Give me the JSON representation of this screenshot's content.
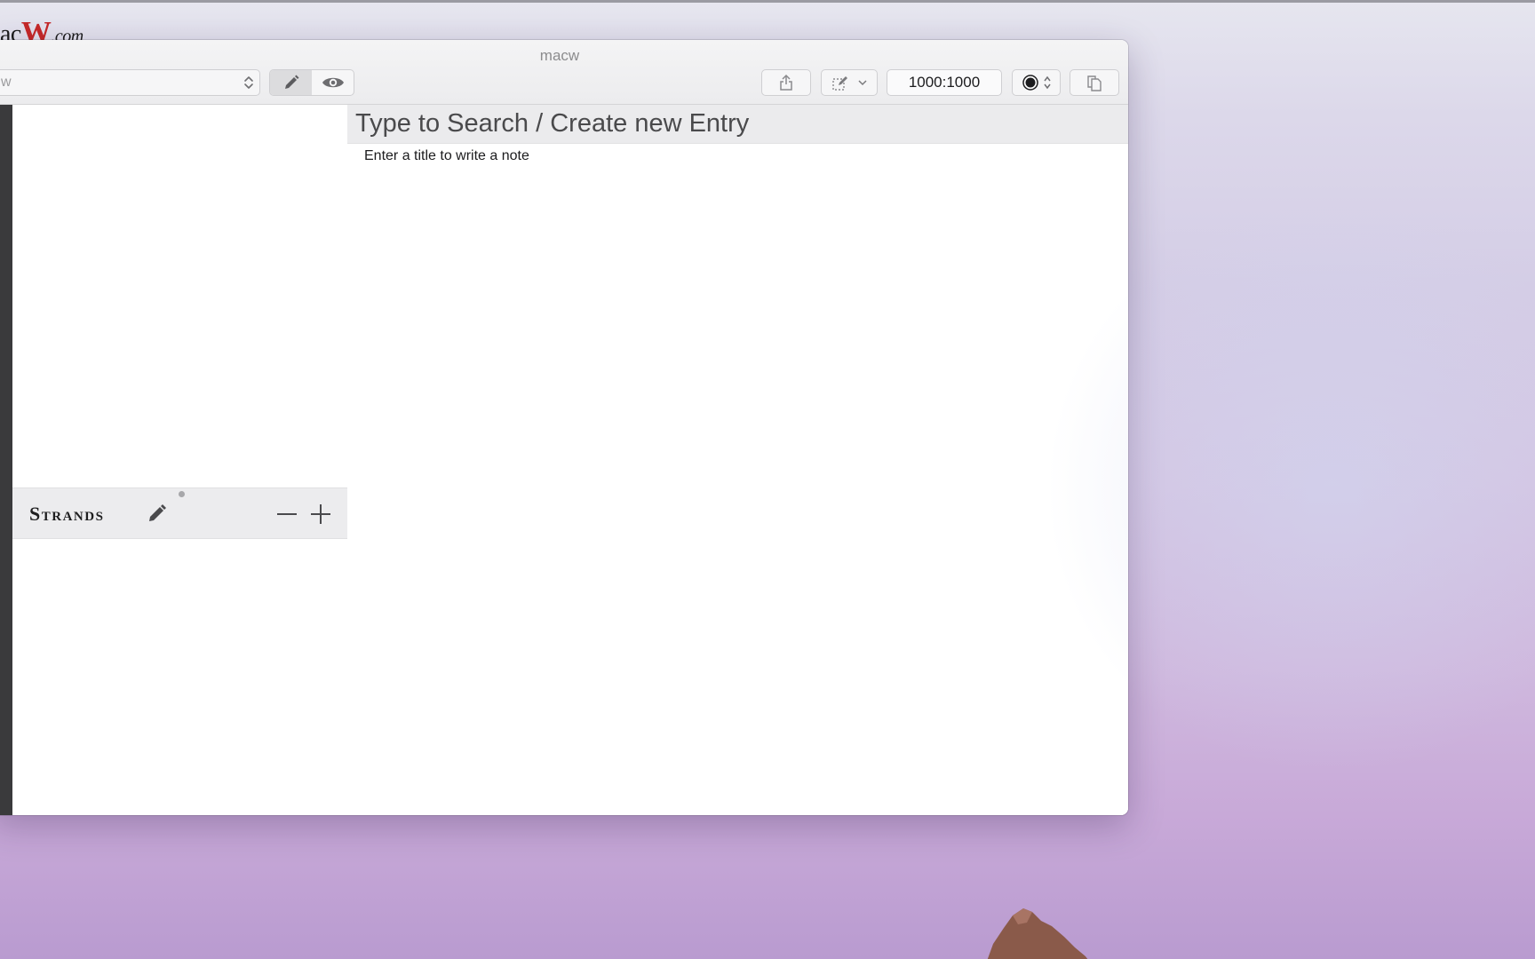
{
  "watermark": {
    "text_a": "ac",
    "text_w": "W",
    "text_com": ".com"
  },
  "window": {
    "title": "macw"
  },
  "toolbar": {
    "database_select_value": "w",
    "ratio_value": "1000:1000",
    "icons": {
      "edit_mode": "pencil-icon",
      "preview_mode": "eye-icon",
      "share": "share-icon",
      "edit_menu": "edit-selection-icon",
      "color": "radio-dot-icon",
      "copy": "copy-documents-icon"
    }
  },
  "sidebar": {
    "strands_label": "Strands",
    "icons": {
      "edit": "pencil-icon",
      "remove": "minus-icon",
      "add": "plus-icon"
    }
  },
  "main": {
    "search_placeholder": "Type to Search / Create new Entry",
    "editor_hint": "Enter a title to write a note"
  },
  "colors": {
    "active_mode_bg": "#dcdcde",
    "watermark_accent": "#c62828"
  }
}
